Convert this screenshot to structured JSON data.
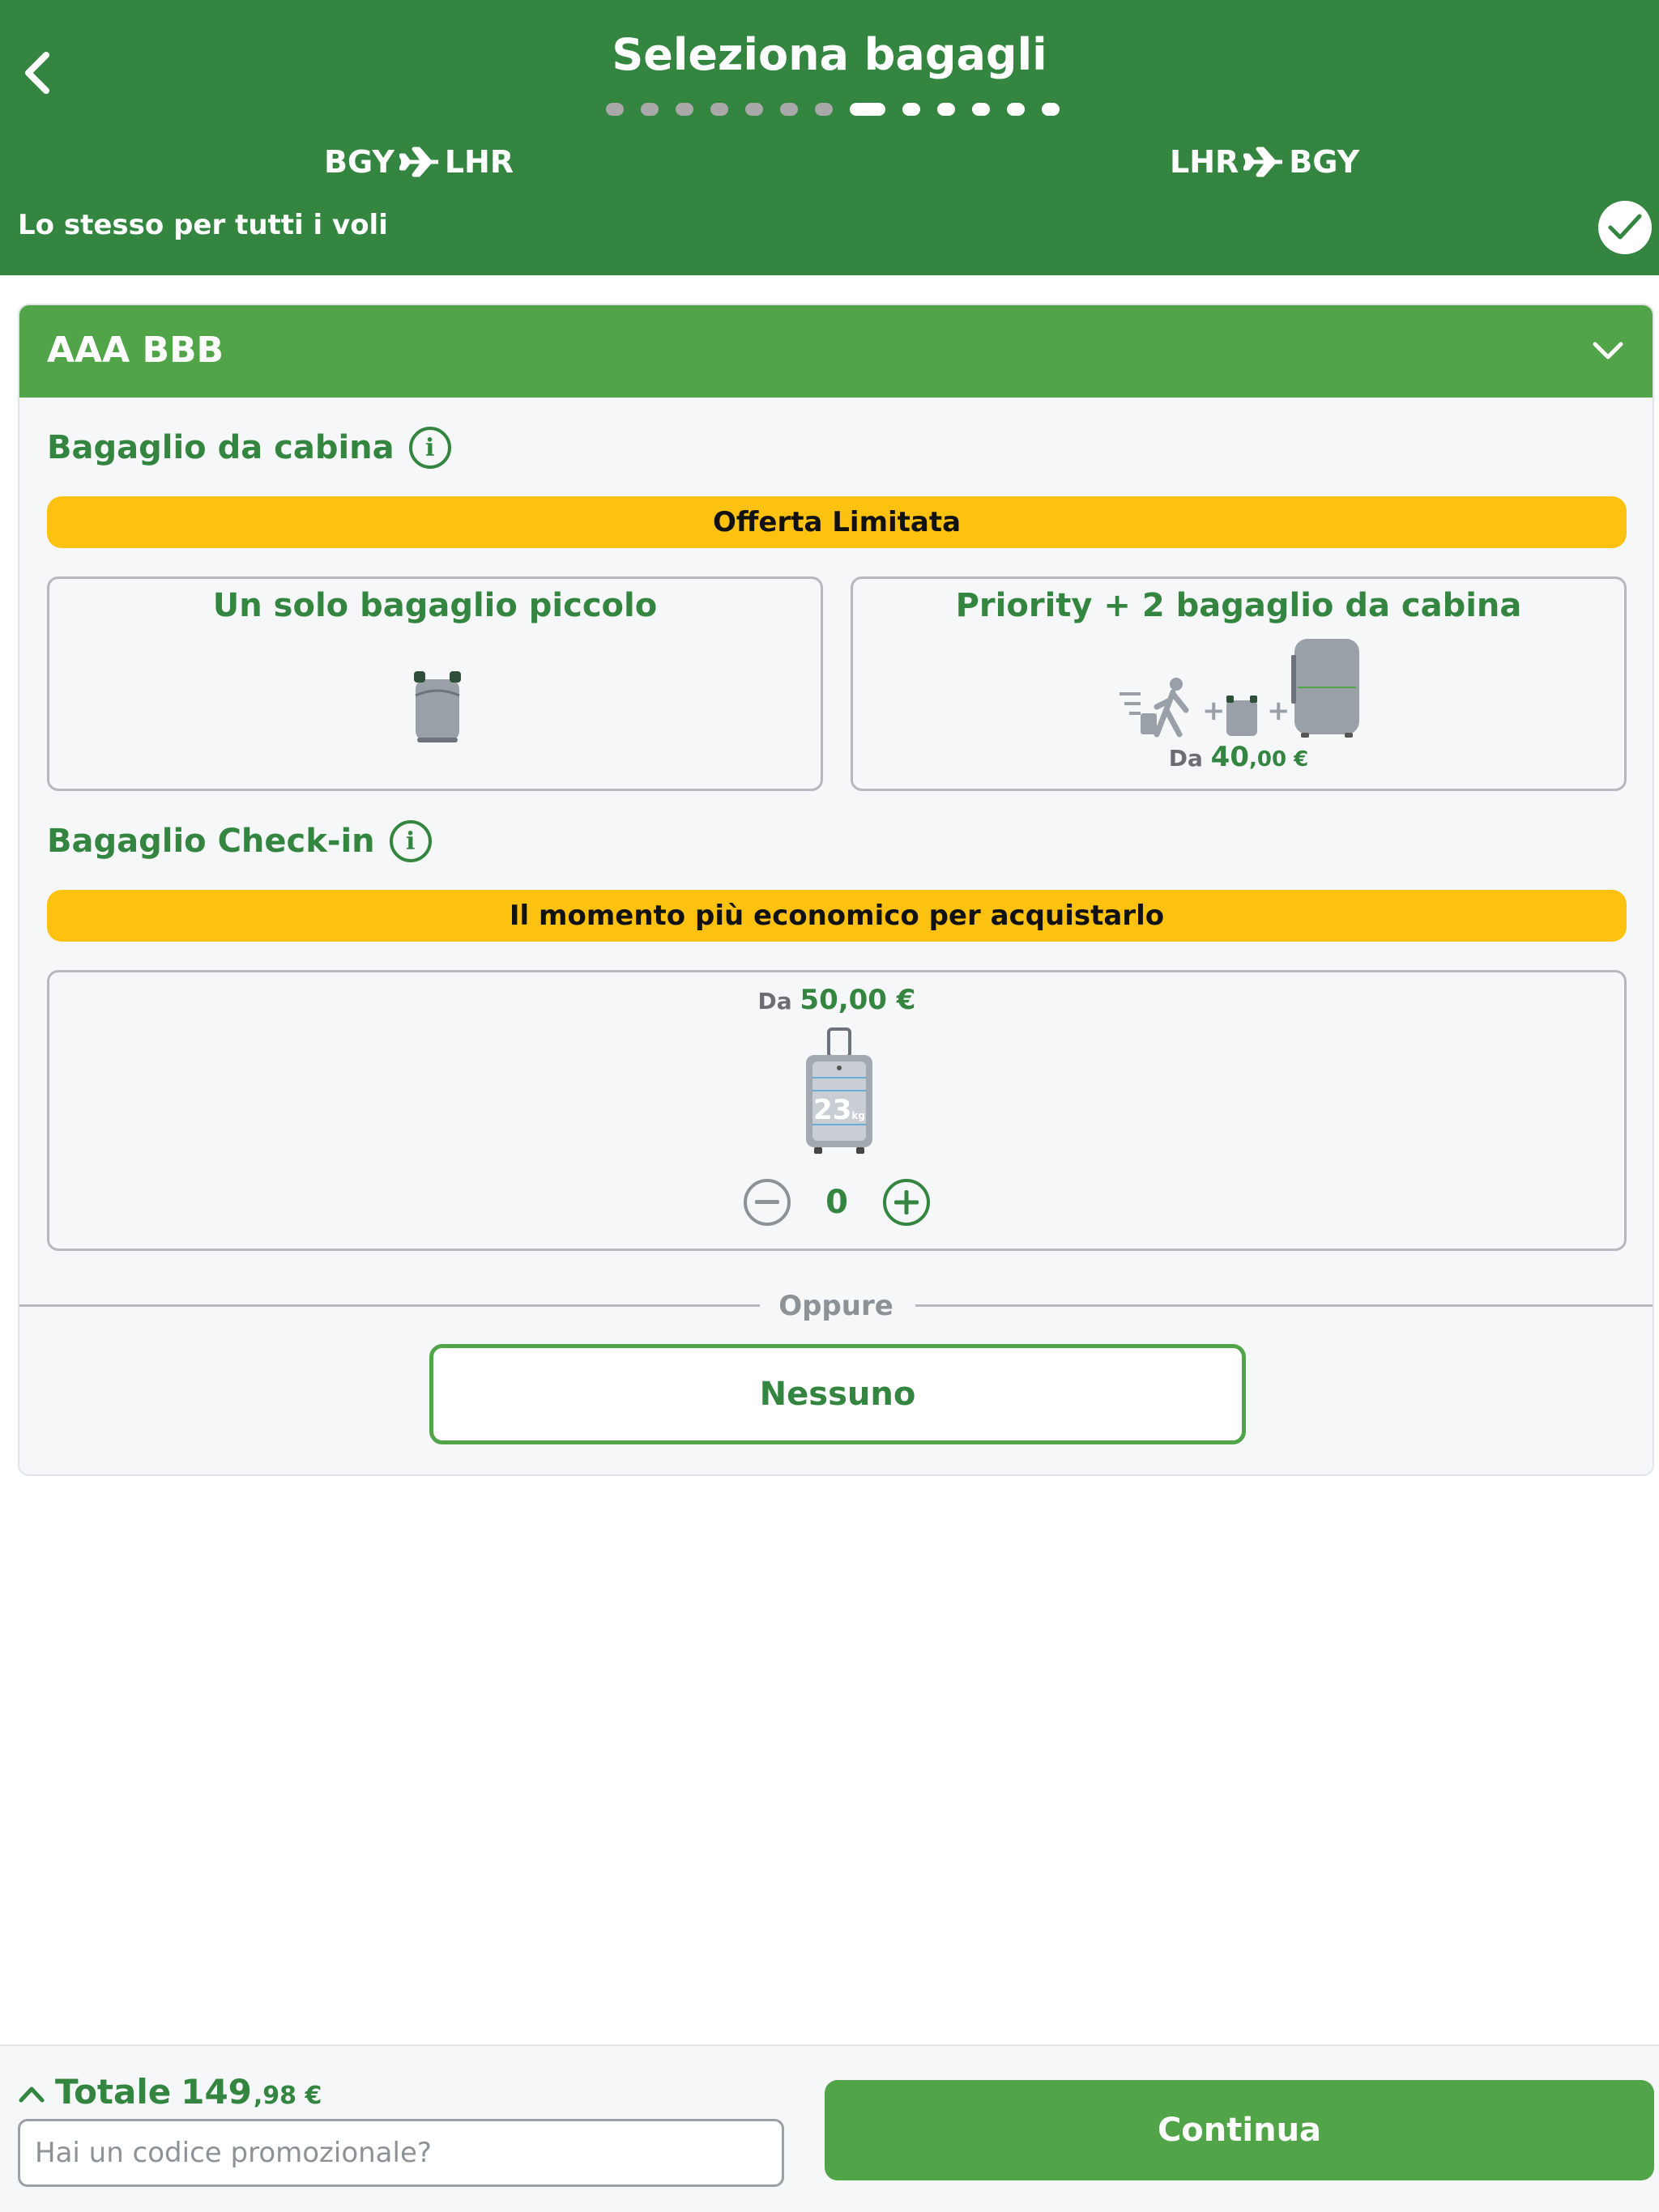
{
  "header": {
    "title": "Seleziona bagagli",
    "progress": {
      "total_steps": 13,
      "current_step": 8
    },
    "routes": [
      {
        "from": "BGY",
        "to": "LHR"
      },
      {
        "from": "LHR",
        "to": "BGY"
      }
    ],
    "same_for_all_label": "Lo stesso per tutti i voli",
    "same_for_all_checked": true
  },
  "passenger": {
    "name": "AAA BBB",
    "cabin": {
      "title": "Bagaglio da cabina",
      "banner": "Offerta Limitata",
      "options": [
        {
          "title": "Un solo bagaglio piccolo"
        },
        {
          "title": "Priority + 2 bagaglio da cabina",
          "price_prefix": "Da",
          "price_int": "40",
          "price_dec": ",00 €"
        }
      ]
    },
    "checkin": {
      "title": "Bagaglio Check-in",
      "banner": "Il momento più economico per acquistarlo",
      "price_prefix": "Da",
      "price": "50,00 €",
      "weight": "23",
      "weight_unit": "kg",
      "quantity": "0"
    },
    "or_label": "Oppure",
    "none_label": "Nessuno"
  },
  "footer": {
    "total_label": "Totale",
    "total_int": "149",
    "total_dec": ",98 €",
    "promo_placeholder": "Hai un codice promozionale?",
    "continue_label": "Continua"
  },
  "colors": {
    "header_green": "#338540",
    "accent_green": "#52a448",
    "banner_yellow": "#fdc10f",
    "muted_gray": "#8d9297"
  }
}
